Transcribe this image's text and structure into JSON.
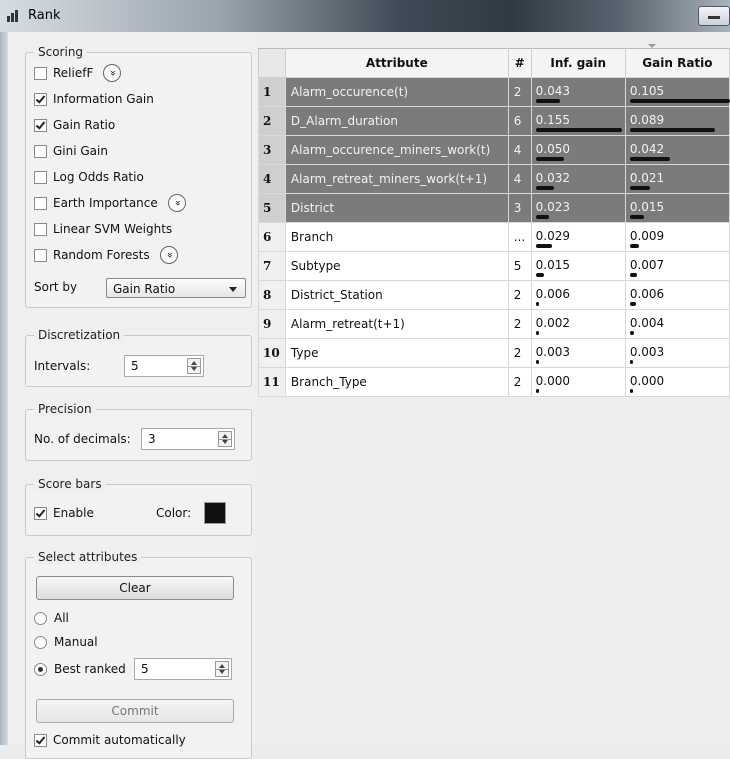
{
  "window": {
    "title": "Rank"
  },
  "scoring": {
    "title": "Scoring",
    "methods": [
      {
        "label": "ReliefF",
        "checked": false,
        "expand": true
      },
      {
        "label": "Information Gain",
        "checked": true,
        "expand": false
      },
      {
        "label": "Gain Ratio",
        "checked": true,
        "expand": false
      },
      {
        "label": "Gini Gain",
        "checked": false,
        "expand": false
      },
      {
        "label": "Log Odds Ratio",
        "checked": false,
        "expand": false
      },
      {
        "label": "Earth Importance",
        "checked": false,
        "expand": true
      },
      {
        "label": "Linear SVM Weights",
        "checked": false,
        "expand": false
      },
      {
        "label": "Random Forests",
        "checked": false,
        "expand": true
      }
    ],
    "sort_label": "Sort by",
    "sort_value": "Gain Ratio"
  },
  "discretization": {
    "title": "Discretization",
    "intervals_label": "Intervals:",
    "intervals_value": "5"
  },
  "precision": {
    "title": "Precision",
    "decimals_label": "No. of decimals:",
    "decimals_value": "3"
  },
  "score_bars": {
    "title": "Score bars",
    "enable_label": "Enable",
    "enable_checked": true,
    "color_label": "Color:",
    "color": "#111111"
  },
  "select_attributes": {
    "title": "Select attributes",
    "clear_label": "Clear",
    "options": [
      {
        "label": "All",
        "selected": false
      },
      {
        "label": "Manual",
        "selected": false
      },
      {
        "label": "Best ranked",
        "selected": true
      }
    ],
    "best_ranked_value": "5",
    "commit_label": "Commit",
    "commit_auto_label": "Commit automatically",
    "commit_auto_checked": true
  },
  "table": {
    "headers": [
      "Attribute",
      "#",
      "Inf. gain",
      "Gain Ratio"
    ],
    "rows": [
      {
        "idx": "1",
        "attr": "Alarm_occurence(t)",
        "num": "2",
        "inf": "0.043",
        "ratio": "0.105",
        "inf_v": 0.043,
        "ratio_v": 0.105,
        "selected": true
      },
      {
        "idx": "2",
        "attr": "D_Alarm_duration",
        "num": "6",
        "inf": "0.155",
        "ratio": "0.089",
        "inf_v": 0.155,
        "ratio_v": 0.089,
        "selected": true
      },
      {
        "idx": "3",
        "attr": "Alarm_occurence_miners_work(t)",
        "num": "4",
        "inf": "0.050",
        "ratio": "0.042",
        "inf_v": 0.05,
        "ratio_v": 0.042,
        "selected": true
      },
      {
        "idx": "4",
        "attr": "Alarm_retreat_miners_work(t+1)",
        "num": "4",
        "inf": "0.032",
        "ratio": "0.021",
        "inf_v": 0.032,
        "ratio_v": 0.021,
        "selected": true
      },
      {
        "idx": "5",
        "attr": "District",
        "num": "3",
        "inf": "0.023",
        "ratio": "0.015",
        "inf_v": 0.023,
        "ratio_v": 0.015,
        "selected": true
      },
      {
        "idx": "6",
        "attr": "Branch",
        "num": "...",
        "inf": "0.029",
        "ratio": "0.009",
        "inf_v": 0.029,
        "ratio_v": 0.009,
        "selected": false
      },
      {
        "idx": "7",
        "attr": "Subtype",
        "num": "5",
        "inf": "0.015",
        "ratio": "0.007",
        "inf_v": 0.015,
        "ratio_v": 0.007,
        "selected": false
      },
      {
        "idx": "8",
        "attr": "District_Station",
        "num": "2",
        "inf": "0.006",
        "ratio": "0.006",
        "inf_v": 0.006,
        "ratio_v": 0.006,
        "selected": false
      },
      {
        "idx": "9",
        "attr": "Alarm_retreat(t+1)",
        "num": "2",
        "inf": "0.002",
        "ratio": "0.004",
        "inf_v": 0.002,
        "ratio_v": 0.004,
        "selected": false
      },
      {
        "idx": "10",
        "attr": "Type",
        "num": "2",
        "inf": "0.003",
        "ratio": "0.003",
        "inf_v": 0.003,
        "ratio_v": 0.003,
        "selected": false
      },
      {
        "idx": "11",
        "attr": "Branch_Type",
        "num": "2",
        "inf": "0.000",
        "ratio": "0.000",
        "inf_v": 0.0,
        "ratio_v": 0.0,
        "selected": false
      }
    ]
  }
}
